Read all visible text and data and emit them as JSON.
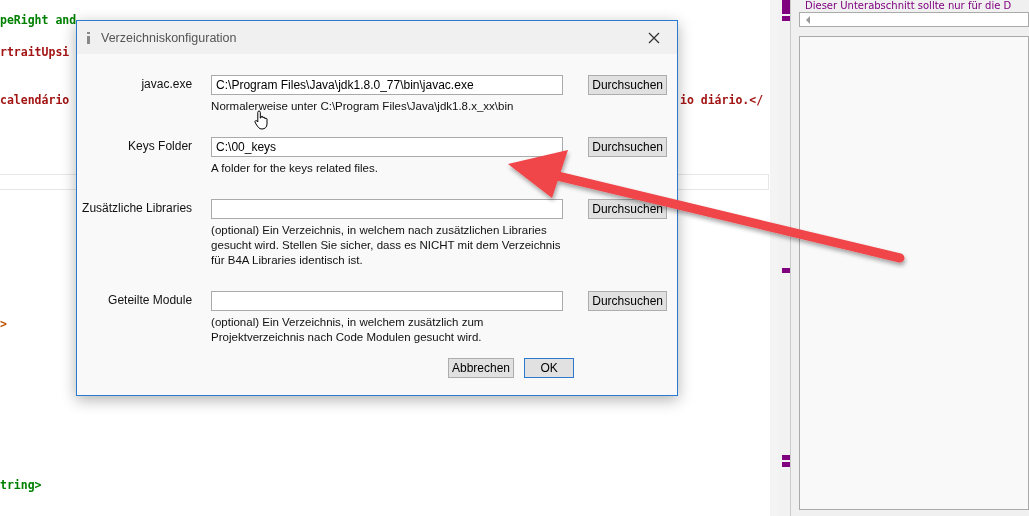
{
  "editor": {
    "lines": [
      {
        "text": "peRight and",
        "color": "#008000"
      },
      {
        "text": "rtraitUpsi",
        "color": "#a31515"
      },
      {
        "text": "calendário",
        "color": "#a31515"
      },
      {
        "text": "io diário.</",
        "color": "#a31515"
      },
      {
        "text": ">",
        "color": "#c05000"
      },
      {
        "text": "tring>",
        "color": "#008000"
      }
    ]
  },
  "side_panel": {
    "heading": "Dieser Unterabschnitt sollte nur für die D"
  },
  "dialog": {
    "title": "Verzeichniskonfiguration",
    "rows": [
      {
        "label": "javac.exe",
        "value": "C:\\Program Files\\Java\\jdk1.8.0_77\\bin\\javac.exe",
        "hint": "Normalerweise unter C:\\Program Files\\Java\\jdk1.8.x_xx\\bin",
        "button": "Durchsuchen"
      },
      {
        "label": "Keys Folder",
        "value": "C:\\00_keys",
        "hint": "A folder for the keys related files.",
        "button": "Durchsuchen"
      },
      {
        "label": "Zusätzliche Libraries",
        "hint": "(optional) Ein Verzeichnis, in welchem nach zusätzlichen Libraries gesucht wird. Stellen Sie sicher, dass es NICHT mit dem Verzeichnis für B4A Libraries identisch ist.",
        "button": "Durchsuchen"
      },
      {
        "label": "Geteilte Module",
        "hint": "(optional) Ein Verzeichnis, in welchem zusätzlich zum Projektverzeichnis nach Code Modulen gesucht wird.",
        "button": "Durchsuchen"
      }
    ],
    "buttons": [
      {
        "label": "Abbrechen",
        "selected": false
      },
      {
        "label": "OK",
        "selected": true
      }
    ]
  }
}
